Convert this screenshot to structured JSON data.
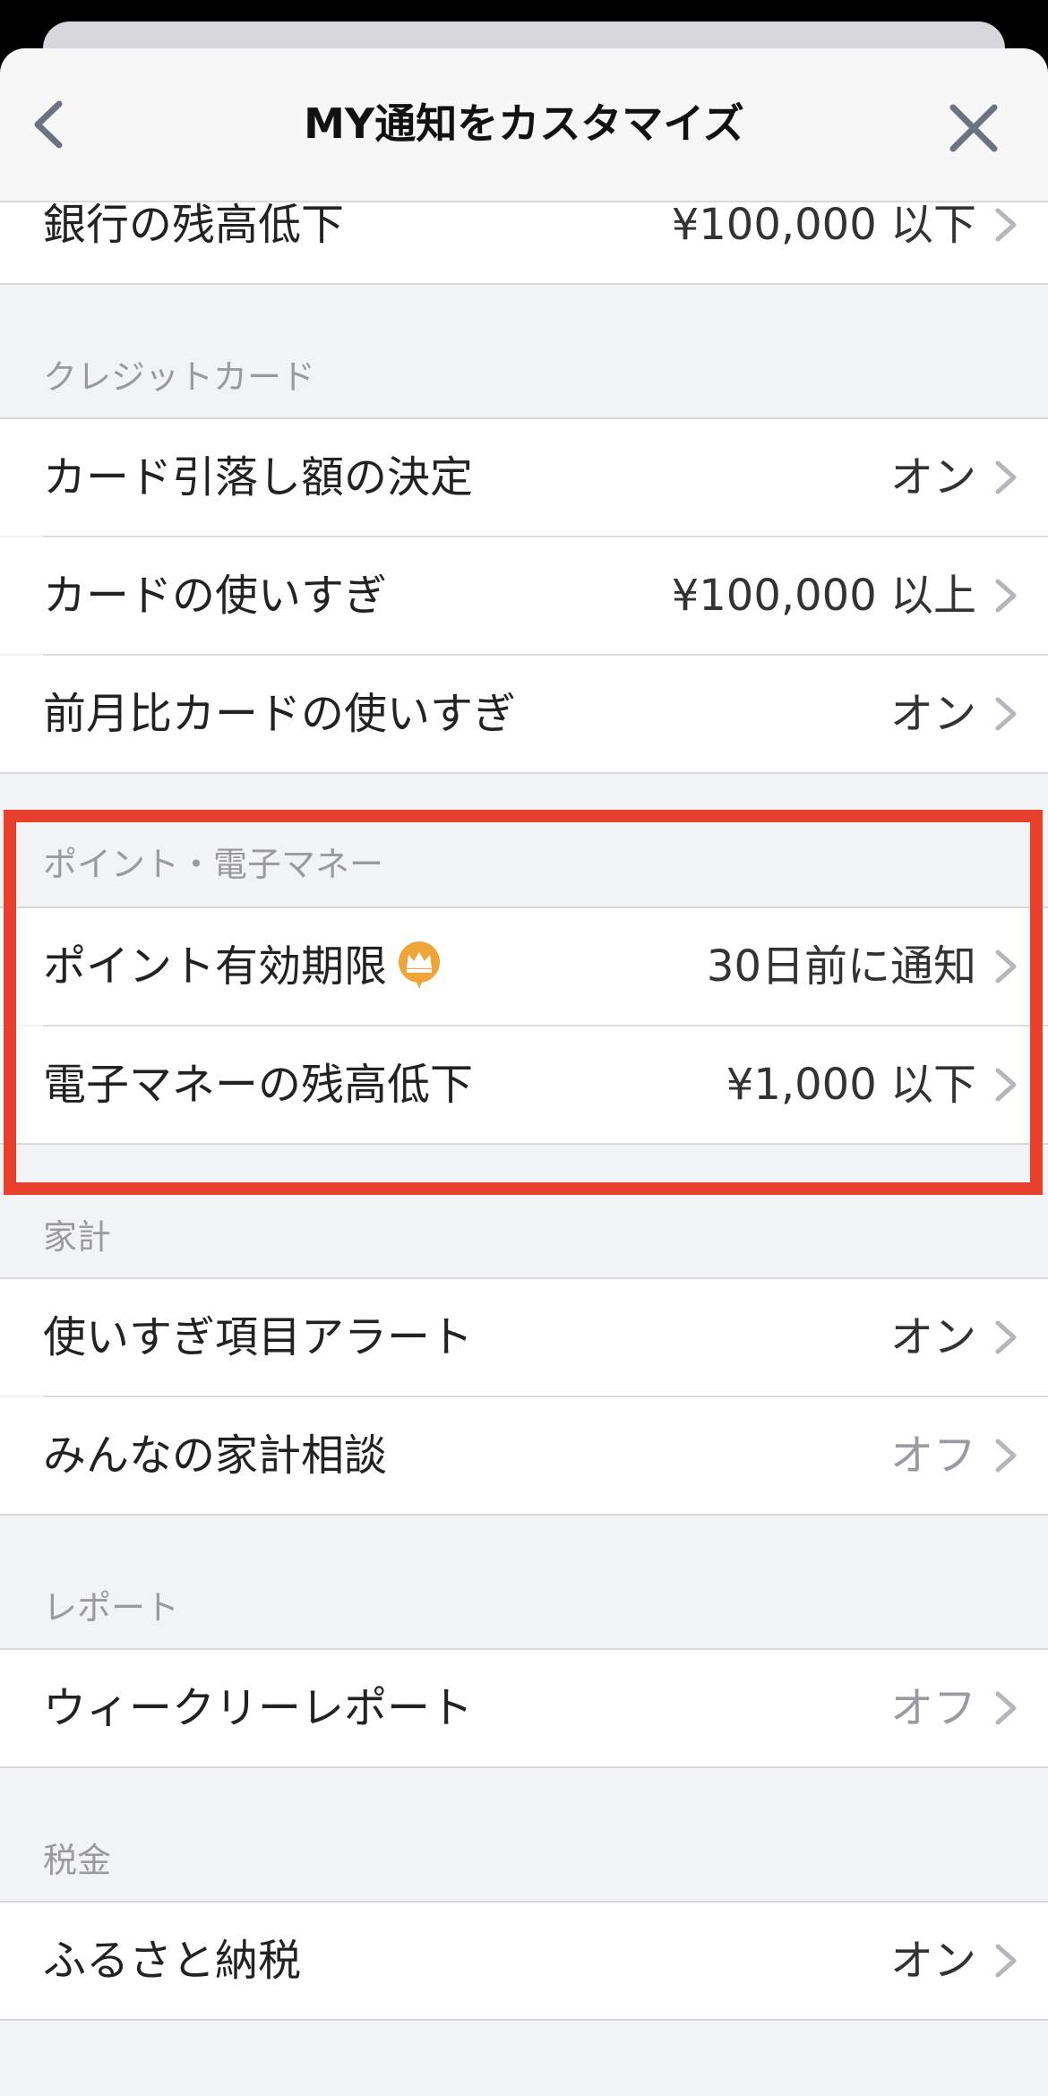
{
  "header": {
    "title": "MY通知をカスタマイズ",
    "back_icon": "chevron-left-icon",
    "close_icon": "close-icon"
  },
  "sections": {
    "bank": {
      "rows": [
        {
          "label": "銀行の残高低下",
          "value": "¥100,000 以下"
        }
      ]
    },
    "credit_card": {
      "header": "クレジットカード",
      "rows": [
        {
          "label": "カード引落し額の決定",
          "value": "オン"
        },
        {
          "label": "カードの使いすぎ",
          "value": "¥100,000 以上"
        },
        {
          "label": "前月比カードの使いすぎ",
          "value": "オン"
        }
      ]
    },
    "points": {
      "header": "ポイント・電子マネー",
      "rows": [
        {
          "label": "ポイント有効期限",
          "value": "30日前に通知",
          "badge_icon": "premium-crown-icon"
        },
        {
          "label": "電子マネーの残高低下",
          "value": "¥1,000 以下"
        }
      ]
    },
    "household": {
      "header": "家計",
      "rows": [
        {
          "label": "使いすぎ項目アラート",
          "value": "オン"
        },
        {
          "label": "みんなの家計相談",
          "value": "オフ"
        }
      ]
    },
    "report": {
      "header": "レポート",
      "rows": [
        {
          "label": "ウィークリーレポート",
          "value": "オフ"
        }
      ]
    },
    "tax": {
      "header": "税金",
      "rows": [
        {
          "label": "ふるさと納税",
          "value": "オン"
        }
      ]
    }
  },
  "colors": {
    "highlight": "#e8402d",
    "crown_badge": "#f0a53a",
    "off_text": "#9a9aa0"
  }
}
